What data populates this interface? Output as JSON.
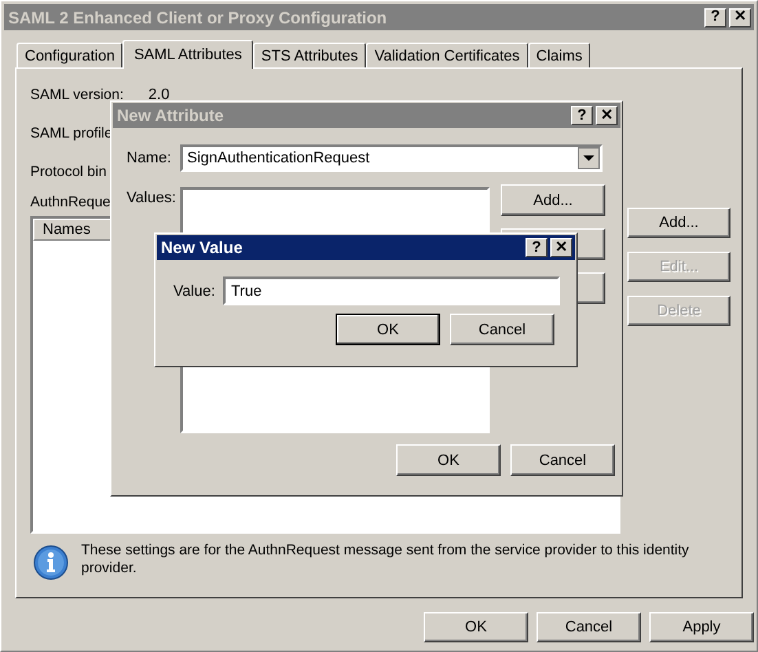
{
  "window": {
    "title": "SAML 2 Enhanced Client or Proxy Configuration",
    "active": false,
    "help": "?",
    "close": "✕"
  },
  "tabs": [
    {
      "label": "Configuration",
      "selected": false
    },
    {
      "label": "SAML Attributes",
      "selected": true
    },
    {
      "label": "STS Attributes",
      "selected": false
    },
    {
      "label": "Validation Certificates",
      "selected": false
    },
    {
      "label": "Claims",
      "selected": false
    }
  ],
  "fields": [
    {
      "label": "SAML version:",
      "value": "2.0"
    },
    {
      "label": "SAML profile"
    },
    {
      "label": "Protocol bin"
    },
    {
      "label": "AuthnReque"
    }
  ],
  "attribute_list": {
    "columns": [
      "Names"
    ]
  },
  "side_buttons": [
    {
      "label": "Add...",
      "disabled": false
    },
    {
      "label": "Edit...",
      "disabled": true
    },
    {
      "label": "Delete",
      "disabled": true
    }
  ],
  "info": "These settings are for the AuthnRequest message sent from the service provider to this identity provider.",
  "buttons": [
    "OK",
    "Cancel",
    "Apply"
  ],
  "new_attribute": {
    "title": "New Attribute",
    "active": false,
    "help": "?",
    "close": "✕",
    "name_label": "Name:",
    "name_value": "SignAuthenticationRequest",
    "values_label": "Values:",
    "add_button": "Add...",
    "buttons": [
      "OK",
      "Cancel"
    ]
  },
  "new_value": {
    "title": "New Value",
    "active": true,
    "help": "?",
    "close": "✕",
    "value_label": "Value:",
    "value": "True",
    "buttons": [
      "OK",
      "Cancel"
    ]
  }
}
